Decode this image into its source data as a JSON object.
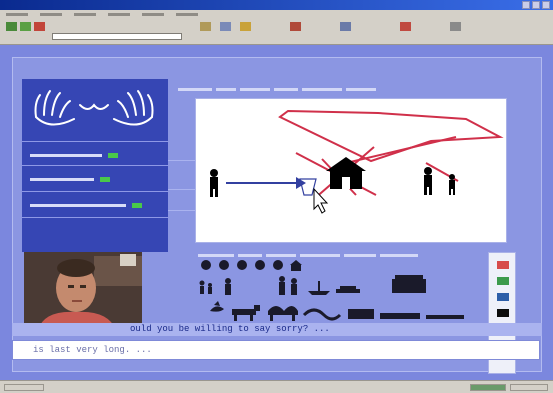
{
  "ticker": {
    "text": "ould you be willing to say sorry? ..."
  },
  "input_line": {
    "text": "is last very long. ..."
  },
  "colors": {
    "swatches": [
      "#d74b4b",
      "#3c9a4c",
      "#2d5ea8",
      "#0c0c0c",
      "#f0f0f0"
    ]
  }
}
